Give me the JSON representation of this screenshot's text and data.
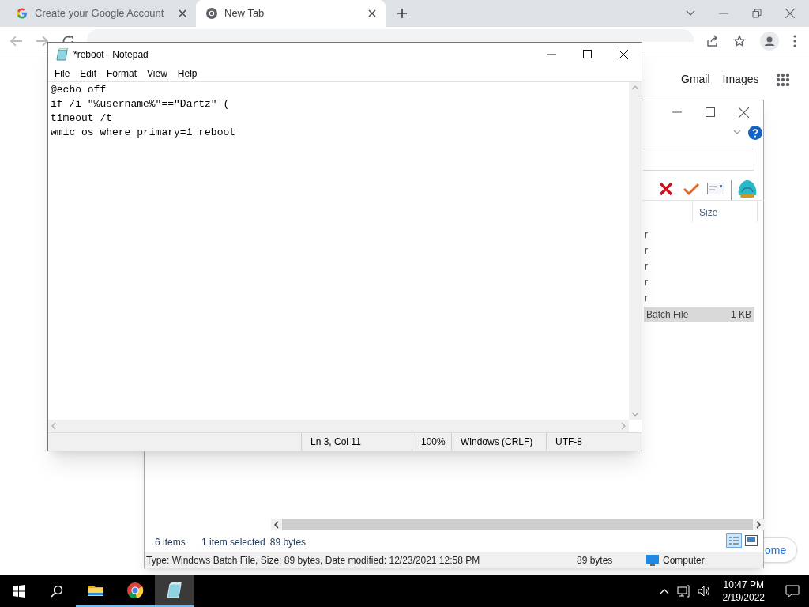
{
  "browser": {
    "tabs": [
      {
        "title": "Create your Google Account",
        "selected": false,
        "kind": "google"
      },
      {
        "title": "New Tab",
        "selected": true,
        "kind": "chrome"
      }
    ],
    "links": [
      "Gmail",
      "Images"
    ],
    "customize_button": "ome"
  },
  "explorer": {
    "column": "Size",
    "rows": [
      {
        "column_1": "r",
        "selected": false
      },
      {
        "column_1": "r",
        "selected": false
      },
      {
        "column_1": "r",
        "selected": false
      },
      {
        "column_1": "r",
        "selected": false
      },
      {
        "column_1": "r",
        "selected": false
      },
      {
        "column_1": "Batch File",
        "size": "1 KB",
        "selected": true
      }
    ],
    "item_count": "6 items",
    "selection": "1 item selected",
    "selection_size": "89 bytes",
    "details": "Type: Windows Batch File, Size: 89 bytes, Date modified: 12/23/2021 12:58 PM",
    "details_size": "89 bytes",
    "zone": "Computer"
  },
  "notepad": {
    "title": "*reboot - Notepad",
    "menu": [
      "File",
      "Edit",
      "Format",
      "View",
      "Help"
    ],
    "lines": [
      "@echo off",
      "if /i \"%username%\"==\"Dartz\" (",
      "timeout /t",
      "wmic os where primary=1 reboot"
    ],
    "status": [
      "Ln 3, Col 11",
      "100%",
      "Windows (CRLF)",
      "UTF-8"
    ]
  },
  "taskbar": {
    "apps": [
      {
        "kind": "explorer",
        "active": false
      },
      {
        "kind": "chrome",
        "active": false
      },
      {
        "kind": "notepad",
        "active": true
      }
    ],
    "time": "10:47 PM",
    "date": "2/19/2022"
  }
}
